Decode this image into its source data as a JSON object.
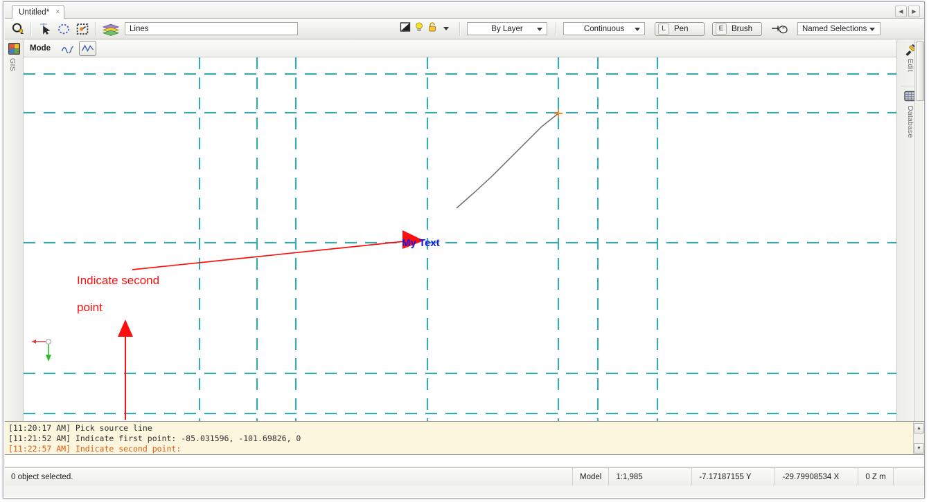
{
  "window": {
    "document_tab": "Untitled*",
    "tab_close_glyph": "×",
    "scroll_left_glyph": "◀",
    "scroll_right_glyph": "▶"
  },
  "toolbar": {
    "icons": [
      {
        "name": "object-snap-icon",
        "title": "Object Snap"
      },
      {
        "name": "select-arrow-icon",
        "title": "Select"
      },
      {
        "name": "lasso-select-icon",
        "title": "Lasso Select"
      },
      {
        "name": "fence-select-icon",
        "title": "Fence Select"
      },
      {
        "name": "layers-icon",
        "title": "Layers"
      }
    ],
    "layer_name": "Lines",
    "color_icon": "color-swatch-icon",
    "light_icon": "lightbulb-icon",
    "lock_icon": "padlock-icon",
    "layer_caret": "caret-down-icon",
    "color_combo": "By Layer",
    "linetype_combo": "Continuous",
    "pen_button": {
      "key": "L",
      "label": "Pen"
    },
    "brush_button": {
      "key": "E",
      "label": "Brush"
    },
    "pick_icon": "pick-tool-icon",
    "named_selections": "Named Selections"
  },
  "modebar": {
    "label": "Mode",
    "buttons": [
      {
        "name": "mode-spline-icon",
        "active": false
      },
      {
        "name": "mode-polyline-icon",
        "active": true
      }
    ]
  },
  "left_rail": {
    "icon": "gis-palette-icon",
    "label": "GIS"
  },
  "right_rail": {
    "items": [
      {
        "icon": "edit-tools-icon",
        "label": "Edit"
      },
      {
        "icon": "database-grid-icon",
        "label": "Database"
      }
    ]
  },
  "canvas": {
    "grid_color": "#3aa8ac",
    "line_color": "#6b6b6b",
    "snap_marker_color": "#f08a2b",
    "annotation_color": "#fb0f0f",
    "text_color": "#1b19e0",
    "annotations": [
      {
        "name": "indicate-second-point-note",
        "line1": "Indicate second",
        "line2": "point"
      }
    ],
    "drawing_text": "My Text",
    "axis": {
      "x_color": "#e23b3b",
      "y_color": "#2fbf2f",
      "origin_color": "#bdbdbd"
    }
  },
  "log": {
    "lines": [
      {
        "text": "[11:20:17 AM] Pick source line",
        "current": false
      },
      {
        "text": "[11:21:52 AM] Indicate first point: -85.031596, -101.69826, 0",
        "current": false
      },
      {
        "text": "[11:22:57 AM] Indicate second point:",
        "current": true
      }
    ],
    "scroll_up_glyph": "▲",
    "scroll_down_glyph": "▼"
  },
  "command_input": {
    "value": "",
    "placeholder": ""
  },
  "statusbar": {
    "selection": "0 object selected.",
    "space": "Model",
    "scale": "1:1,985",
    "coord_y": "-7.17187155 Y",
    "coord_x": "-29.79908534 X",
    "coord_z": "0  Z  m"
  }
}
